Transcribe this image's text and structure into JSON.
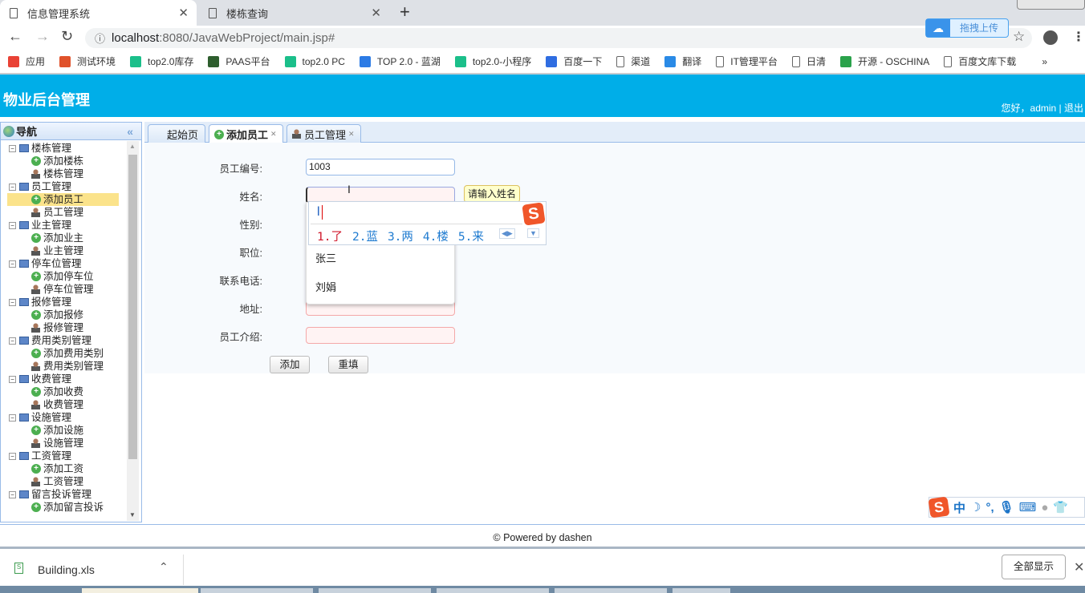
{
  "browser": {
    "tabs": [
      {
        "title": "信息管理系统",
        "active": true
      },
      {
        "title": "楼栋查询",
        "active": false
      }
    ],
    "url_host": "localhost",
    "url_rest": ":8080/JavaWebProject/main.jsp#",
    "bookmarks": [
      {
        "label": "应用",
        "icon": "apps-icon",
        "color": "#e94235"
      },
      {
        "label": "测试环境",
        "icon": "u-icon",
        "color": "#e0522b"
      },
      {
        "label": "top2.0库存",
        "icon": "play-icon",
        "color": "#1bbf8a"
      },
      {
        "label": "PAAS平台",
        "icon": "panda-icon",
        "color": "#2e5e2e"
      },
      {
        "label": "top2.0 PC",
        "icon": "play-icon",
        "color": "#1bbf8a"
      },
      {
        "label": "TOP 2.0 - 蓝湖",
        "icon": "lanhu-icon",
        "color": "#2c7be5"
      },
      {
        "label": "top2.0-小程序",
        "icon": "play-icon",
        "color": "#1bbf8a"
      },
      {
        "label": "百度一下",
        "icon": "baidu-icon",
        "color": "#2f6de1"
      },
      {
        "label": "渠道",
        "icon": "page-icon",
        "color": ""
      },
      {
        "label": "翻译",
        "icon": "translate-icon",
        "color": "#2a8ae6"
      },
      {
        "label": "IT管理平台",
        "icon": "page-icon",
        "color": ""
      },
      {
        "label": "日清",
        "icon": "page-icon",
        "color": ""
      },
      {
        "label": "开源 - OSCHINA",
        "icon": "oschina-icon",
        "color": "#2aa24b"
      },
      {
        "label": "百度文库下载",
        "icon": "page-icon",
        "color": ""
      }
    ],
    "more": "»",
    "baidu_upload": "拖拽上传"
  },
  "header": {
    "title": "物业后台管理",
    "user_text": "您好，admin | 退出"
  },
  "nav": {
    "title": "导航",
    "collapse": "«",
    "groups": [
      {
        "label": "楼栋管理",
        "children": [
          "添加楼栋",
          "楼栋管理"
        ]
      },
      {
        "label": "员工管理",
        "children": [
          "添加员工",
          "员工管理"
        ]
      },
      {
        "label": "业主管理",
        "children": [
          "添加业主",
          "业主管理"
        ]
      },
      {
        "label": "停车位管理",
        "children": [
          "添加停车位",
          "停车位管理"
        ]
      },
      {
        "label": "报修管理",
        "children": [
          "添加报修",
          "报修管理"
        ]
      },
      {
        "label": "费用类别管理",
        "children": [
          "添加费用类别",
          "费用类别管理"
        ]
      },
      {
        "label": "收费管理",
        "children": [
          "添加收费",
          "收费管理"
        ]
      },
      {
        "label": "设施管理",
        "children": [
          "添加设施",
          "设施管理"
        ]
      },
      {
        "label": "工资管理",
        "children": [
          "添加工资",
          "工资管理"
        ]
      },
      {
        "label": "留言投诉管理",
        "children": [
          "添加留言投诉"
        ]
      }
    ],
    "selected": "添加员工"
  },
  "main_tabs": [
    {
      "label": "起始页"
    },
    {
      "label": "添加员工",
      "active": true
    },
    {
      "label": "员工管理"
    }
  ],
  "form": {
    "fields": [
      {
        "label": "员工编号:",
        "value": "1003"
      },
      {
        "label": "姓名:",
        "value": ""
      },
      {
        "label": "性别:",
        "value": ""
      },
      {
        "label": "职位:",
        "value": ""
      },
      {
        "label": "联系电话:",
        "value": ""
      },
      {
        "label": "地址:",
        "value": ""
      },
      {
        "label": "员工介绍:",
        "value": ""
      }
    ],
    "tooltip": "请输入姓名",
    "add_label": "添加",
    "reset_label": "重填",
    "autocomplete": [
      "张三",
      "刘娟"
    ]
  },
  "ime": {
    "input": "l",
    "candidates": [
      "1.了",
      "2.蓝",
      "3.两",
      "4.楼",
      "5.来"
    ],
    "logo": "S",
    "toolbar_mode": "中"
  },
  "footer": "© Powered by dashen",
  "downloads": {
    "file": "Building.xls",
    "show_all": "全部显示"
  }
}
